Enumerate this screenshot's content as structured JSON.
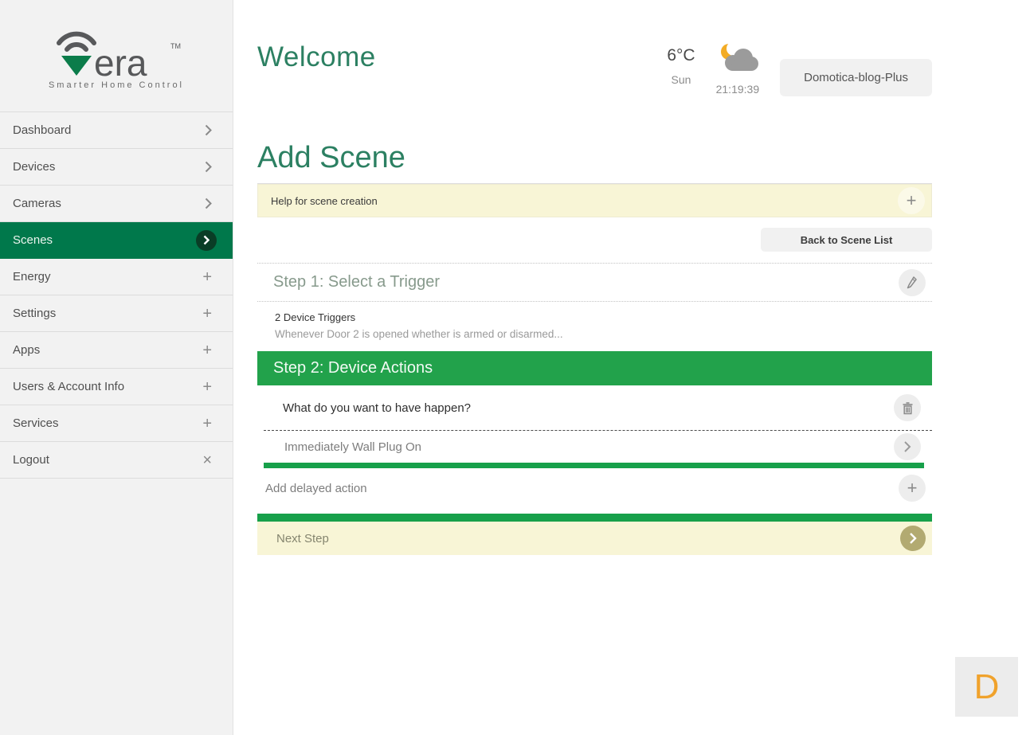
{
  "app": {
    "brand_word_suffix": "era",
    "brand_tm": "TM",
    "tagline": "Smarter Home Control"
  },
  "sidebar": {
    "items": [
      {
        "label": "Dashboard",
        "icon": "chevron-right-icon"
      },
      {
        "label": "Devices",
        "icon": "chevron-right-icon"
      },
      {
        "label": "Cameras",
        "icon": "chevron-right-icon"
      },
      {
        "label": "Scenes",
        "icon": "chevron-right-circle-icon",
        "active": true
      },
      {
        "label": "Energy",
        "icon": "plus-icon"
      },
      {
        "label": "Settings",
        "icon": "plus-icon"
      },
      {
        "label": "Apps",
        "icon": "plus-icon"
      },
      {
        "label": "Users & Account Info",
        "icon": "plus-icon"
      },
      {
        "label": "Services",
        "icon": "plus-icon"
      },
      {
        "label": "Logout",
        "icon": "close-icon"
      }
    ]
  },
  "header": {
    "title": "Welcome",
    "weather": {
      "temperature": "6°C",
      "day": "Sun",
      "time": "21:19:39",
      "icon": "cloud-moon-icon"
    },
    "controller": "Domotica-blog-Plus"
  },
  "scene_page": {
    "title": "Add Scene",
    "help_bar": {
      "label": "Help for scene creation",
      "icon": "plus-icon"
    },
    "back_button": "Back to Scene List",
    "step1": {
      "title": "Step 1: Select a Trigger",
      "edit_icon": "pencil-icon",
      "triggers_count": "2 Device Triggers",
      "trigger_description": "Whenever Door 2 is opened whether is armed or disarmed..."
    },
    "step2": {
      "title": "Step 2: Device Actions",
      "question": "What do you want to have happen?",
      "delete_icon": "trash-icon",
      "immediate_action": "Immediately Wall Plug On",
      "add_delayed_label": "Add delayed action",
      "add_icon": "plus-icon"
    },
    "next_step": "Next Step"
  },
  "overlay": {
    "badge": "D"
  },
  "icons": {
    "plus": "+",
    "close": "×"
  },
  "colors": {
    "sidebar_active_green": "#00784B",
    "step_header_green": "#22A24B",
    "heading_green": "#2C8062",
    "help_yellow": "#F8F5D6",
    "next_circle_olive": "#B2AA71",
    "badge_orange": "#F0A22C"
  }
}
